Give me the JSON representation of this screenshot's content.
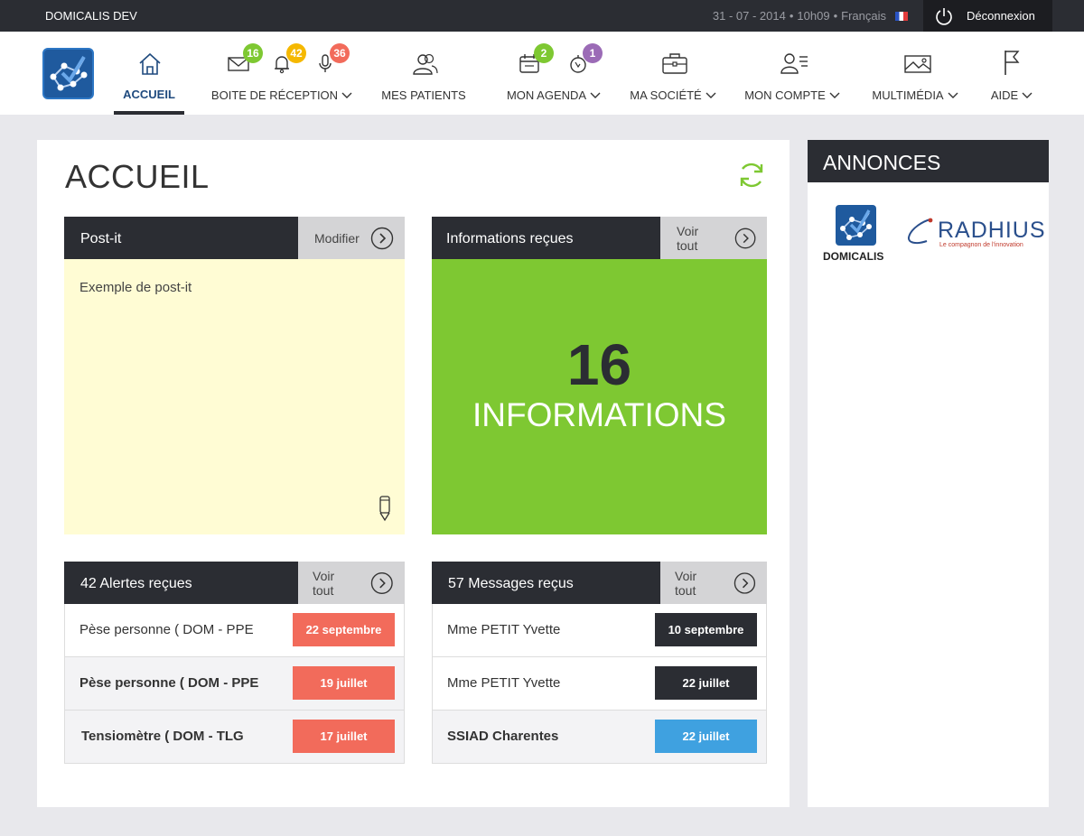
{
  "topbar": {
    "app_name": "DOMICALIS DEV",
    "date": "31 - 07 - 2014",
    "time": "10h09",
    "language": "Français",
    "logout_label": "Déconnexion"
  },
  "nav": {
    "items": [
      {
        "label": "ACCUEIL"
      },
      {
        "label": "BOITE DE RÉCEPTION"
      },
      {
        "label": "MES PATIENTS"
      },
      {
        "label": "MON AGENDA"
      },
      {
        "label": "MA SOCIÉTÉ"
      },
      {
        "label": "MON COMPTE"
      },
      {
        "label": "MULTIMÉDIA"
      },
      {
        "label": "AIDE"
      }
    ],
    "badges": {
      "messages": "16",
      "alerts": "42",
      "voice": "36",
      "agenda": "2",
      "timer": "1"
    }
  },
  "main": {
    "title": "ACCUEIL",
    "postit": {
      "title": "Post-it",
      "action": "Modifier",
      "content": "Exemple de post-it"
    },
    "info": {
      "title": "Informations reçues",
      "action": "Voir tout",
      "count": "16",
      "label": "INFORMATIONS"
    },
    "alerts": {
      "title": "42 Alertes reçues",
      "action": "Voir tout",
      "rows": [
        {
          "name": "Pèse personne ( DOM - PPE",
          "date": "22 septembre"
        },
        {
          "name": "Pèse personne ( DOM - PPE",
          "date": "19 juillet"
        },
        {
          "name": "Tensiomètre ( DOM - TLG",
          "date": "17 juillet"
        }
      ]
    },
    "messages": {
      "title": "57 Messages reçus",
      "action": "Voir tout",
      "rows": [
        {
          "name": "Mme PETIT Yvette",
          "date": "10 septembre"
        },
        {
          "name": "Mme PETIT Yvette",
          "date": "22 juillet"
        },
        {
          "name": "SSIAD Charentes",
          "date": "22 juillet"
        }
      ]
    }
  },
  "side": {
    "title": "ANNONCES",
    "domicalis_label": "DOMICALIS",
    "radhius_label": "RADHIUS",
    "radhius_tagline": "Le compagnon de l'innovation"
  },
  "colors": {
    "dark": "#2b2d33",
    "green": "#7ec832",
    "alert_red": "#f26b5b",
    "blue": "#3fa1e0",
    "postit_yellow": "#fffcd4"
  }
}
